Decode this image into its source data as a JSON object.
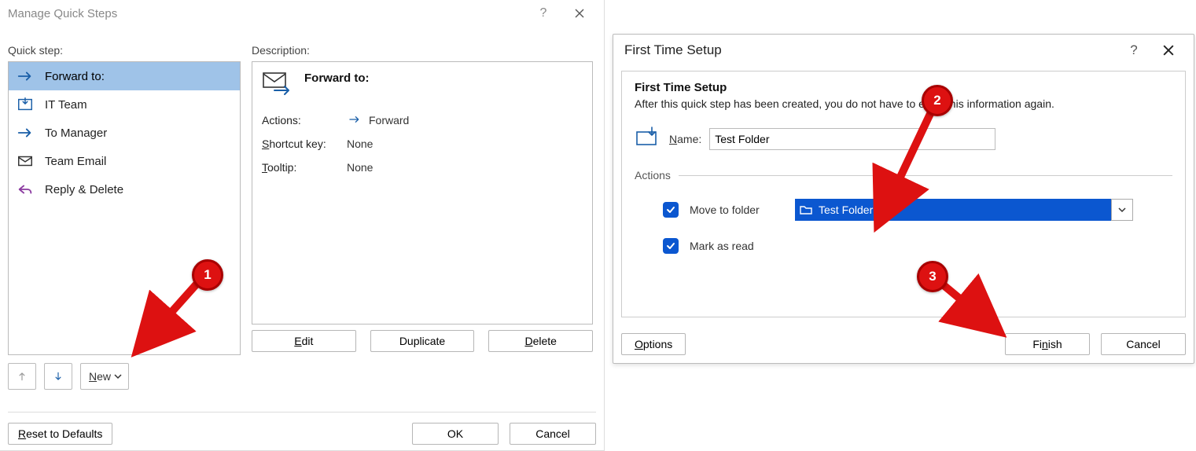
{
  "annotations": {
    "b1": "1",
    "b2": "2",
    "b3": "3"
  },
  "manage": {
    "title": "Manage Quick Steps",
    "quick_step_label": "Quick step:",
    "description_label": "Description:",
    "items": [
      {
        "label": "Forward to:",
        "icon": "arrow-right"
      },
      {
        "label": "IT Team",
        "icon": "inbox-down"
      },
      {
        "label": "To Manager",
        "icon": "arrow-right"
      },
      {
        "label": "Team Email",
        "icon": "mail"
      },
      {
        "label": "Reply & Delete",
        "icon": "reply"
      }
    ],
    "desc": {
      "title": "Forward to:",
      "actions_label": "Actions:",
      "actions_value": "Forward",
      "shortcut_label_pre": "S",
      "shortcut_label_rest": "hortcut key:",
      "shortcut_value": "None",
      "tooltip_label_pre": "T",
      "tooltip_label_rest": "ooltip:",
      "tooltip_value": "None",
      "buttons": {
        "edit_pre": "E",
        "edit_rest": "dit",
        "duplicate": "Duplicate",
        "delete_pre": "D",
        "delete_rest": "elete"
      }
    },
    "new_label_pre": "N",
    "new_label_rest": "ew",
    "reset_label_pre": "R",
    "reset_label_rest": "eset to Defaults",
    "ok_label": "OK",
    "cancel_label": "Cancel"
  },
  "fts": {
    "title": "First Time Setup",
    "h1": "First Time Setup",
    "sub": "After this quick step has been created, you do not have to enter this information again.",
    "name_label_pre": "N",
    "name_label_rest": "ame:",
    "name_value": "Test Folder",
    "actions_head": "Actions",
    "move_label": "Move to folder",
    "folder_value": "Test Folder",
    "mark_label": "Mark as read",
    "options_label_pre": "O",
    "options_label_rest": "ptions",
    "finish_label_pre": "Fi",
    "finish_label_mid": "n",
    "finish_label_rest": "ish",
    "cancel_label": "Cancel"
  }
}
